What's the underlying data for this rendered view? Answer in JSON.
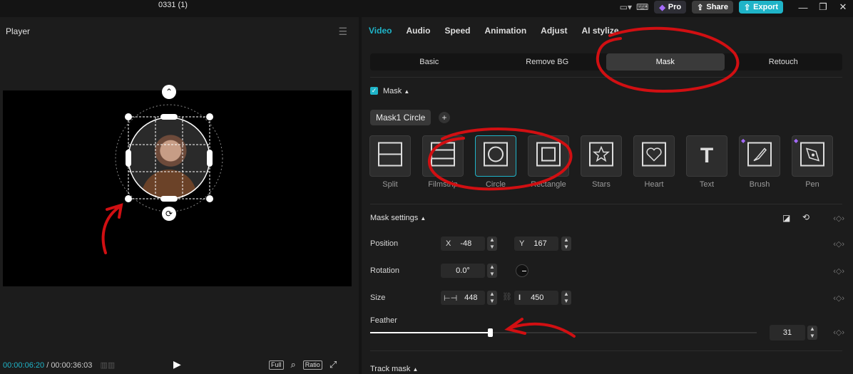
{
  "app": {
    "project_title": "0331 (1)",
    "buttons": {
      "pro": "Pro",
      "share": "Share",
      "export": "Export"
    }
  },
  "player": {
    "title": "Player",
    "time_current": "00:00:06:20",
    "time_separator": "/",
    "time_total": "00:00:36:03",
    "buttons": {
      "full": "Full",
      "ratio": "Ratio"
    }
  },
  "inspector": {
    "tabs": [
      "Video",
      "Audio",
      "Speed",
      "Animation",
      "Adjust",
      "AI stylize"
    ],
    "active_tab": "Video",
    "subtabs": [
      "Basic",
      "Remove BG",
      "Mask",
      "Retouch"
    ],
    "active_subtab": "Mask",
    "mask_section": {
      "title": "Mask",
      "enabled": true,
      "chip": "Mask1 Circle",
      "shapes": [
        {
          "label": "Split",
          "icon": "split-icon"
        },
        {
          "label": "Filmstrip",
          "icon": "filmstrip-icon"
        },
        {
          "label": "Circle",
          "icon": "circle-icon"
        },
        {
          "label": "Rectangle",
          "icon": "rectangle-icon"
        },
        {
          "label": "Stars",
          "icon": "star-icon"
        },
        {
          "label": "Heart",
          "icon": "heart-icon"
        },
        {
          "label": "Text",
          "icon": "text-icon"
        },
        {
          "label": "Brush",
          "icon": "brush-icon"
        },
        {
          "label": "Pen",
          "icon": "pen-icon"
        }
      ],
      "selected_shape": "Circle"
    },
    "mask_settings": {
      "title": "Mask settings",
      "position": {
        "label": "Position",
        "x_label": "X",
        "x": "-48",
        "y_label": "Y",
        "y": "167"
      },
      "rotation": {
        "label": "Rotation",
        "value": "0.0°"
      },
      "size": {
        "label": "Size",
        "width": "448",
        "height": "450"
      },
      "feather": {
        "label": "Feather",
        "value": "31",
        "fraction": 0.31
      }
    },
    "track_mask": {
      "title": "Track mask"
    }
  },
  "colors": {
    "accent": "#1fb4c8",
    "annotation": "#d10f12"
  }
}
